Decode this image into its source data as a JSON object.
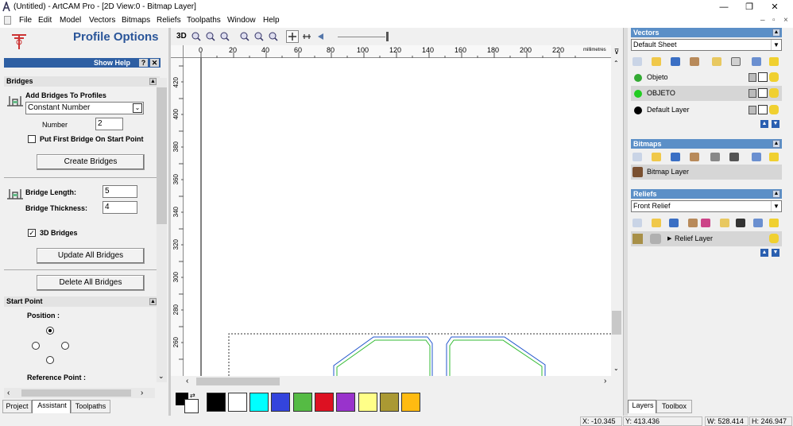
{
  "window": {
    "title": "(Untitled) - ArtCAM Pro - [2D View:0 - Bitmap Layer]",
    "minimize_glyph": "—",
    "maximize_glyph": "❐",
    "close_glyph": "✕"
  },
  "menu": [
    "File",
    "Edit",
    "Model",
    "Vectors",
    "Bitmaps",
    "Reliefs",
    "Toolpaths",
    "Window",
    "Help"
  ],
  "mdi": {
    "minimize": "–",
    "restore": "▫",
    "close": "×"
  },
  "left_panel": {
    "title": "Profile Options",
    "show_help": "Show Help",
    "help_q": "?",
    "help_x": "✕",
    "bridges_header": "Bridges",
    "add_bridges_label": "Add Bridges To Profiles",
    "mode_select": "Constant Number",
    "number_label": "Number",
    "number_value": "2",
    "first_bridge_label": "Put First Bridge On Start Point",
    "create_bridges": "Create Bridges",
    "bridge_length_label": "Bridge Length:",
    "bridge_length_value": "5",
    "bridge_thickness_label": "Bridge Thickness:",
    "bridge_thickness_value": "4",
    "bridges_3d_label": "3D Bridges",
    "update_bridges": "Update All Bridges",
    "delete_bridges": "Delete All Bridges",
    "start_point_header": "Start Point",
    "position_label": "Position :",
    "reference_label": "Reference Point :",
    "tabs": [
      "Project",
      "Assistant",
      "Toolpaths"
    ]
  },
  "view_toolbar": {
    "label_3d": "3D"
  },
  "ruler": {
    "h_ticks": [
      "0",
      "20",
      "40",
      "60",
      "80",
      "100",
      "120",
      "140",
      "160",
      "180",
      "200",
      "220"
    ],
    "units": "millimetres",
    "v_ticks": [
      "420",
      "400",
      "380",
      "360",
      "340",
      "320",
      "300",
      "280",
      "260"
    ]
  },
  "palette": [
    "#000000",
    "#ffffff",
    "#00ffff",
    "#3344dd",
    "#55bb44",
    "#dd1122",
    "#9933cc",
    "#ffff88",
    "#aa9933",
    "#ffbb11"
  ],
  "right_panel": {
    "vectors_header": "Vectors",
    "vectors_sheet": "Default Sheet",
    "layers": [
      {
        "name": "Objeto",
        "color": "#33aa33"
      },
      {
        "name": "OBJETO",
        "color": "#22cc22"
      },
      {
        "name": "Default Layer",
        "color": "#000000"
      }
    ],
    "bitmaps_header": "Bitmaps",
    "bitmap_layer": "Bitmap Layer",
    "reliefs_header": "Reliefs",
    "relief_select": "Front Relief",
    "relief_layer": "Relief Layer",
    "tabs": [
      "Layers",
      "Toolbox"
    ]
  },
  "status": {
    "x": "X: -10.345",
    "y": "Y: 413.436",
    "w": "W: 528.414",
    "h": "H: 246.947"
  }
}
